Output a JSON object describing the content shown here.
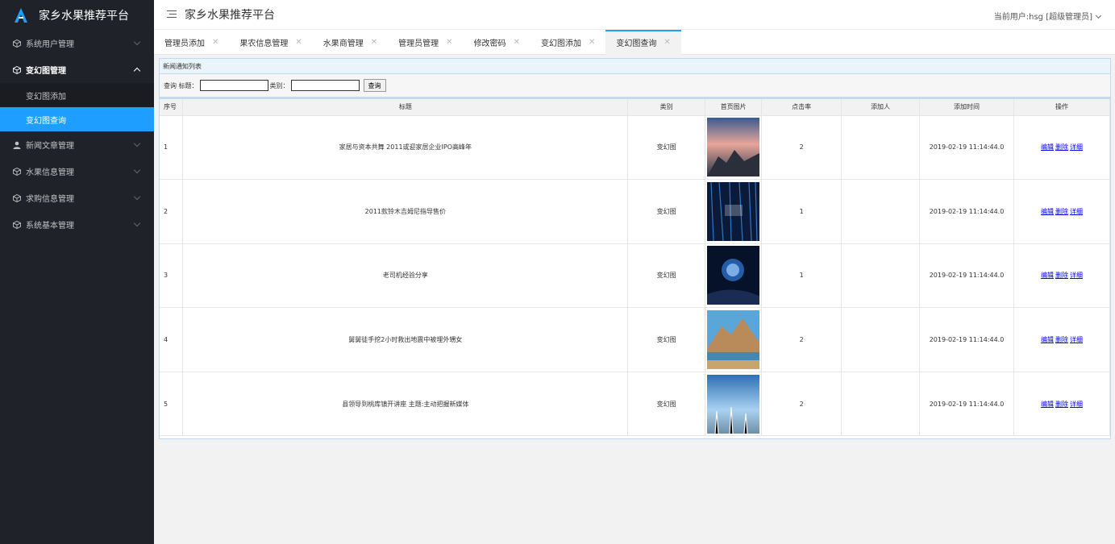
{
  "app": {
    "title": "家乡水果推荐平台"
  },
  "header": {
    "title": "家乡水果推荐平台",
    "user": "当前用户:hsg [超级管理员]"
  },
  "sidebar": {
    "items": [
      {
        "label": "系统用户管理"
      },
      {
        "label": "变幻图管理",
        "sub": [
          "变幻图添加",
          "变幻图查询"
        ]
      },
      {
        "label": "新闻文章管理"
      },
      {
        "label": "水果信息管理"
      },
      {
        "label": "求购信息管理"
      },
      {
        "label": "系统基本管理"
      }
    ]
  },
  "tabs": [
    "管理员添加",
    "果农信息管理",
    "水果商管理",
    "管理员管理",
    "修改密码",
    "变幻图添加",
    "变幻图查询"
  ],
  "panel": {
    "title": "新闻通知列表"
  },
  "search": {
    "label_prefix": "查询 标题：",
    "label_type": "类别：",
    "button": "查询"
  },
  "table": {
    "headers": [
      "序号",
      "标题",
      "类别",
      "首页图片",
      "点击率",
      "添加人",
      "添加时间",
      "操作"
    ],
    "ops": [
      "编辑",
      "删除",
      "详细"
    ],
    "rows": [
      {
        "no": "1",
        "title": "家居与资本共舞 2011或迎家居企业IPO高峰年",
        "type": "变幻图",
        "clicks": "2",
        "adder": "",
        "time": "2019-02-19 11:14:44.0"
      },
      {
        "no": "2",
        "title": "2011款铃木吉姆尼指导售价",
        "type": "变幻图",
        "clicks": "1",
        "adder": "",
        "time": "2019-02-19 11:14:44.0"
      },
      {
        "no": "3",
        "title": "老司机经验分享",
        "type": "变幻图",
        "clicks": "1",
        "adder": "",
        "time": "2019-02-19 11:14:44.0"
      },
      {
        "no": "4",
        "title": "舅舅徒手挖2小时救出地震中被埋外甥女",
        "type": "变幻图",
        "clicks": "2",
        "adder": "",
        "time": "2019-02-19 11:14:44.0"
      },
      {
        "no": "5",
        "title": "县领导到桃库镇开讲座 主题:主动把握新媒体",
        "type": "变幻图",
        "clicks": "2",
        "adder": "",
        "time": "2019-02-19 11:14:44.0"
      }
    ]
  },
  "colors": {
    "sidebar_bg": "#20222a",
    "accent": "#1e9fff",
    "link": "#0000ff"
  }
}
